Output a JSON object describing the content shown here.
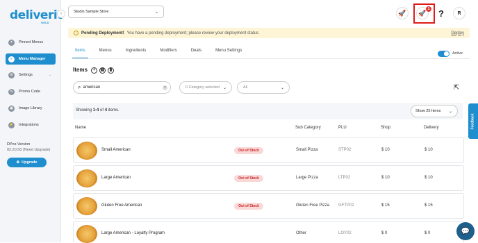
{
  "sidebar": {
    "logo": "deliverit",
    "logo_sub": "GOLD",
    "items": [
      {
        "label": "Pinned Menus",
        "icon": "pin-icon"
      },
      {
        "label": "Menu Manager",
        "icon": "menu-icon",
        "active": true
      },
      {
        "label": "Settings",
        "icon": "gear-icon"
      },
      {
        "label": "Promo Code",
        "icon": "tag-icon"
      },
      {
        "label": "Image Library",
        "icon": "image-icon"
      },
      {
        "label": "Integrations",
        "icon": "plug-icon"
      }
    ],
    "version_label": "DPos Version",
    "version_value": "02.20.50 (Need Upgrade)",
    "upgrade_label": "Upgrade"
  },
  "header": {
    "store": "Studio Sample Store",
    "notification_count": "1",
    "help": "?",
    "avatar": "R"
  },
  "alert": {
    "title": "Pending Deployment!",
    "message": "You have a pending deployment; please review your deployment status.",
    "action": "Deploy"
  },
  "tabs": [
    "Items",
    "Menus",
    "Ingredients",
    "Modifiers",
    "Deals",
    "Menu Settings"
  ],
  "active_label": "Active",
  "items_title": "Items",
  "filters": {
    "search_value": "american",
    "category": "0 Category selected",
    "status": "All"
  },
  "summary": {
    "showing_prefix": "Showing ",
    "range": "1-4",
    "of": " of ",
    "total": "4",
    "suffix": " items."
  },
  "page_size": "Show 25 Items",
  "columns": {
    "name": "Name",
    "sub_category": "Sub Category",
    "plu": "PLU",
    "shop": "Shop",
    "delivery": "Delivery"
  },
  "rows": [
    {
      "name": "Small American",
      "status": "Out of Stock",
      "category": "Small Pizza",
      "plu": "STP02",
      "shop": "$ 10",
      "delivery": "$ 10"
    },
    {
      "name": "Large American",
      "status": "Out of Stock",
      "category": "Large Pizza",
      "plu": "LTP02",
      "shop": "$ 10",
      "delivery": "$ 10"
    },
    {
      "name": "Gluten Free American",
      "status": "Out of Stock",
      "category": "Gluten Free Pizza",
      "plu": "GFTP02",
      "shop": "$ 15",
      "delivery": "$ 15"
    },
    {
      "name": "Large American - Loyalty Program",
      "status": "",
      "category": "Other",
      "plu": "LOY02",
      "shop": "$ 0",
      "delivery": "$ 0"
    }
  ],
  "feedback_label": "Feedback",
  "colors": {
    "accent": "#1f8ecf",
    "alert_bg": "#fdf5d6",
    "out_of_stock": "#c62828"
  }
}
